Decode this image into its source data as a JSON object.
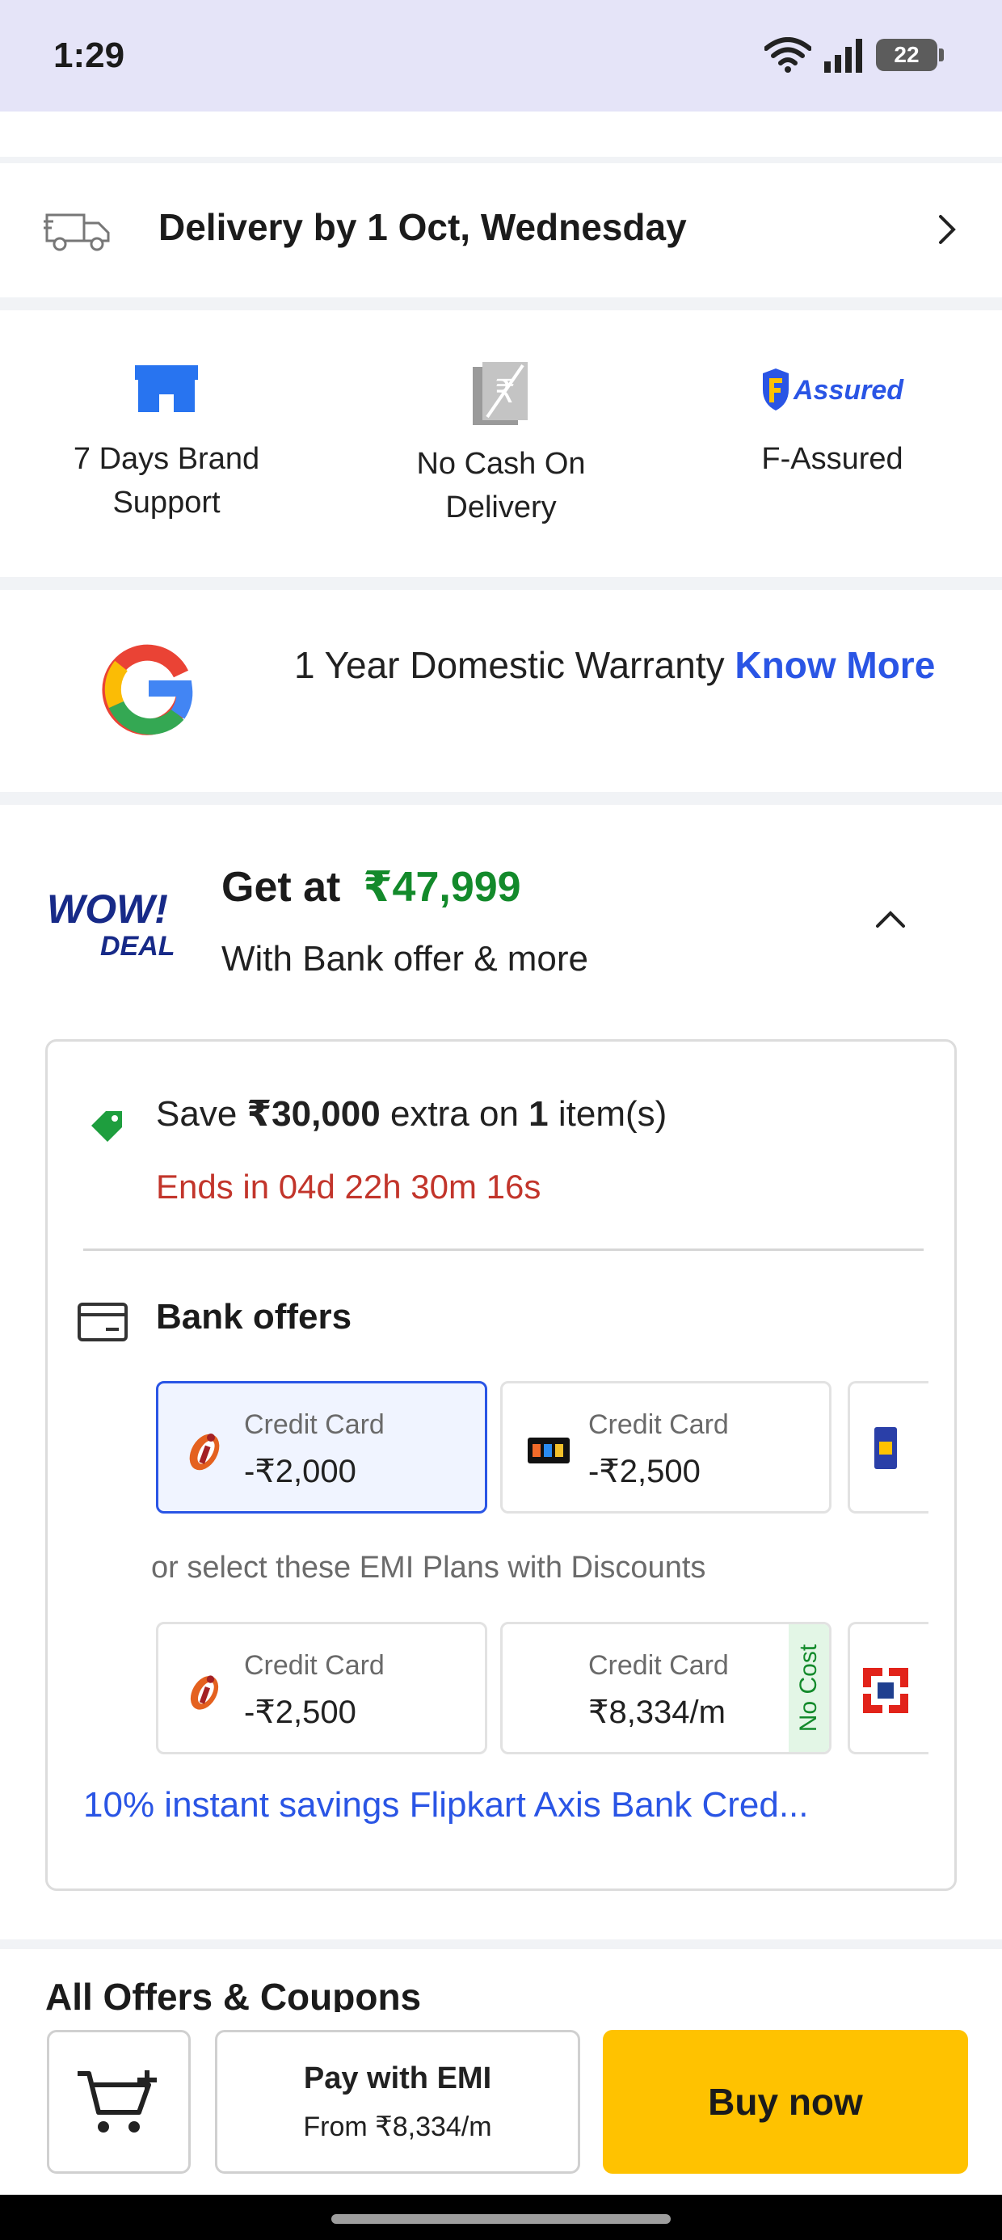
{
  "status_bar": {
    "time": "1:29",
    "battery": "22"
  },
  "delivery": {
    "text": "Delivery by 1 Oct, Wednesday"
  },
  "features": [
    {
      "label": "7 Days Brand Support"
    },
    {
      "label": "No Cash On Delivery"
    },
    {
      "label": "F-Assured"
    }
  ],
  "assured_logo_text": "Assured",
  "warranty": {
    "text": "1 Year Domestic Warranty ",
    "link": "Know More"
  },
  "deal": {
    "logo_line1": "WOW!",
    "logo_line2": "DEAL",
    "get_at": "Get at",
    "price": "₹47,999",
    "subtitle": "With Bank offer & more",
    "save_prefix": "Save ",
    "save_amount": "₹30,000",
    "save_middle": " extra on ",
    "save_count": "1",
    "save_suffix": " item(s)",
    "ends_in": "Ends in  04d 22h 30m 16s",
    "bank_offers_title": "Bank offers",
    "bank_cards": [
      {
        "type": "Credit Card",
        "value": "-₹2,000",
        "selected": true
      },
      {
        "type": "Credit Card",
        "value": "-₹2,500",
        "selected": false
      }
    ],
    "emi_prompt": "or select these EMI Plans with Discounts",
    "emi_cards": [
      {
        "type": "Credit Card",
        "value": "-₹2,500"
      },
      {
        "type": "Credit Card",
        "value": "₹8,334/m",
        "badge": "No Cost"
      }
    ],
    "axis_offer": "10% instant savings Flipkart Axis Bank Cred..."
  },
  "all_offers": "All Offers & Coupons",
  "bottom_bar": {
    "emi_title": "Pay with EMI",
    "emi_sub": "From ₹8,334/m",
    "buy_now": "Buy now"
  },
  "colors": {
    "status_bg": "#e5e4f8",
    "price_green": "#138a2b",
    "link_blue": "#2a55e5",
    "timer_red": "#c2352b",
    "buy_yellow": "#ffc200"
  }
}
